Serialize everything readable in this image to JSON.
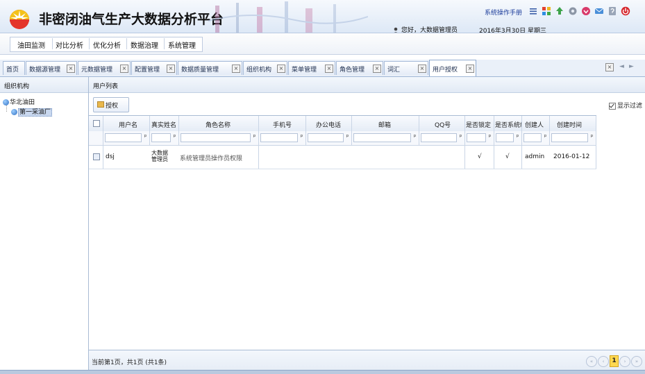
{
  "header": {
    "title": "非密闭油气生产大数据分析平台",
    "user_greeting": "您好，大数据管理员",
    "date": "2016年3月30日 星期三",
    "top_link": "系统操作手册",
    "toolbar_icons": [
      "list-icon",
      "apps-icon",
      "upload-icon",
      "settings-icon",
      "favorite-icon",
      "message-icon",
      "help-icon",
      "power-icon"
    ]
  },
  "menu": {
    "items": [
      "油田监测",
      "对比分析",
      "优化分析",
      "数据治理",
      "系统管理"
    ]
  },
  "tabs": {
    "items": [
      "首页",
      "数据源管理",
      "元数据管理",
      "配置管理",
      "数据质量管理",
      "组织机构",
      "菜单管理",
      "角色管理",
      "词汇",
      "用户授权"
    ],
    "active_index": 9
  },
  "left_panel": {
    "title": "组织机构",
    "tree": {
      "root": "华北油田",
      "child": "第一采油厂"
    }
  },
  "main_panel": {
    "title": "用户列表",
    "grant_button": "授权",
    "show_filter_label": "显示过滤",
    "columns": [
      "用户名",
      "真实姓名",
      "角色名称",
      "手机号",
      "办公电话",
      "邮箱",
      "QQ号",
      "是否锁定",
      "是否系统级",
      "创建人",
      "创建时间"
    ],
    "rows": [
      {
        "username": "dsj",
        "realname": "大数据管理员",
        "role": "系统管理员操作员权限",
        "mobile": "",
        "office_phone": "",
        "email": "",
        "qq": "",
        "locked": "√",
        "system_level": "√",
        "creator": "admin",
        "created": "2016-01-12"
      }
    ],
    "footer_info": "当前第1页，共1页 (共1条)",
    "current_page": "1"
  }
}
